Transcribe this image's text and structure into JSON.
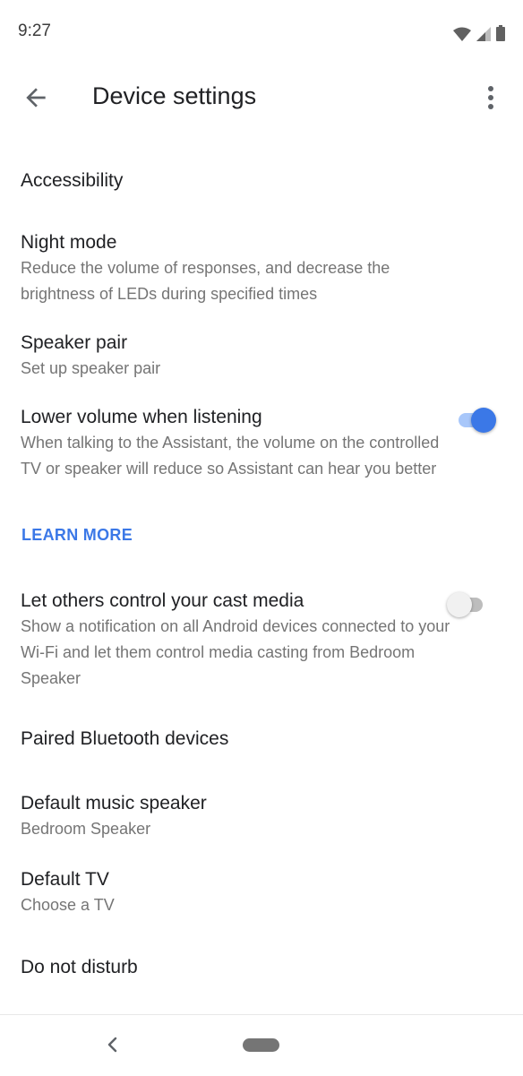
{
  "status_bar": {
    "time": "9:27",
    "icons": [
      "wifi-icon",
      "signal-icon",
      "battery-icon"
    ]
  },
  "app_bar": {
    "title": "Device settings",
    "back_icon": "arrow-back-icon",
    "menu_icon": "more-vert-icon"
  },
  "settings": {
    "accessibility": {
      "title": "Accessibility"
    },
    "night_mode": {
      "title": "Night mode",
      "subtitle": "Reduce the volume of responses, and decrease the brightness of LEDs during specified times"
    },
    "speaker_pair": {
      "title": "Speaker pair",
      "subtitle": "Set up speaker pair"
    },
    "lower_volume": {
      "title": "Lower volume when listening",
      "subtitle": "When talking to the Assistant, the volume on the controlled TV or speaker will reduce so Assistant can hear you better",
      "enabled": true,
      "link": "LEARN MORE"
    },
    "cast_control": {
      "title": "Let others control your cast media",
      "subtitle": "Show a notification on all Android devices connected to your Wi-Fi and let them control media casting from Bedroom Speaker",
      "enabled": false
    },
    "paired_bluetooth": {
      "title": "Paired Bluetooth devices"
    },
    "default_music_speaker": {
      "title": "Default music speaker",
      "subtitle": "Bedroom Speaker"
    },
    "default_tv": {
      "title": "Default TV",
      "subtitle": "Choose a TV"
    },
    "do_not_disturb": {
      "title": "Do not disturb"
    }
  },
  "nav_bar": {
    "back_icon": "nav-back-icon",
    "home_icon": "nav-home-pill-icon"
  },
  "colors": {
    "accent": "#3b78e7",
    "accent_track": "#a8c7fa",
    "text_primary": "#202124",
    "text_secondary": "#757575"
  }
}
